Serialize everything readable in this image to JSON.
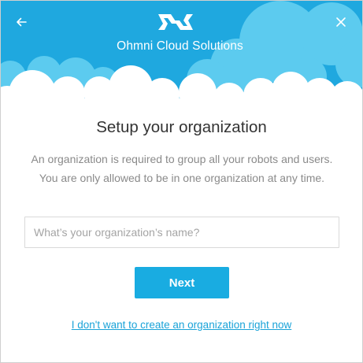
{
  "header": {
    "brand_name": "Ohmni Cloud Solutions",
    "back_icon": "arrow-left-icon",
    "close_icon": "close-icon",
    "logo_icon": "ohmni-logo-icon"
  },
  "main": {
    "title": "Setup your organization",
    "description": "An organization is required to group all your robots and users. You are only allowed to be in one organization at any time.",
    "org_input": {
      "placeholder": "What’s your organization’s name?",
      "value": ""
    },
    "next_label": "Next",
    "skip_label": "I don't want to create an organization right now"
  },
  "colors": {
    "header_sky": "#1fa8df",
    "cloud_light": "#5ccbef",
    "cloud_white": "#ffffff",
    "accent": "#19ace1",
    "link": "#1aa3d8"
  }
}
